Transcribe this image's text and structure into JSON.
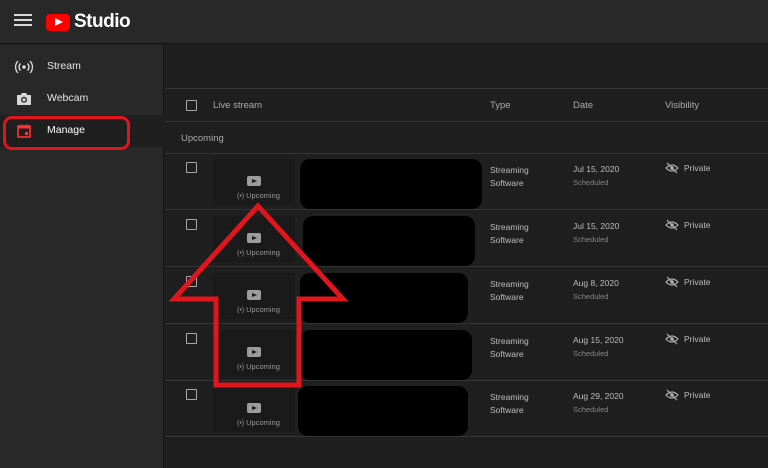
{
  "app": {
    "title": "Studio"
  },
  "colors": {
    "accent_red": "#ff0000",
    "highlight_red": "#e0161c",
    "background": "#1f1f1f",
    "panel": "#282828"
  },
  "sidebar": {
    "items": [
      {
        "label": "Stream",
        "icon": "live-broadcast-icon"
      },
      {
        "label": "Webcam",
        "icon": "camera-icon"
      },
      {
        "label": "Manage",
        "icon": "calendar-icon",
        "active": true
      }
    ]
  },
  "table": {
    "headers": {
      "live_stream": "Live stream",
      "type": "Type",
      "date": "Date",
      "visibility": "Visibility"
    },
    "section": "Upcoming",
    "rows": [
      {
        "thumb_status": "Upcoming",
        "type_line1": "Streaming",
        "type_line2": "Software",
        "date": "Jul 15, 2020",
        "status": "Scheduled",
        "visibility": "Private"
      },
      {
        "thumb_status": "Upcoming",
        "type_line1": "Streaming",
        "type_line2": "Software",
        "date": "Jul 15, 2020",
        "status": "Scheduled",
        "visibility": "Private"
      },
      {
        "thumb_status": "Upcoming",
        "type_line1": "Streaming",
        "type_line2": "Software",
        "date": "Aug 8, 2020",
        "status": "Scheduled",
        "visibility": "Private"
      },
      {
        "thumb_status": "Upcoming",
        "type_line1": "Streaming",
        "type_line2": "Software",
        "date": "Aug 15, 2020",
        "status": "Scheduled",
        "visibility": "Private"
      },
      {
        "thumb_status": "Upcoming",
        "type_line1": "Streaming",
        "type_line2": "Software",
        "date": "Aug 29, 2020",
        "status": "Scheduled",
        "visibility": "Private"
      }
    ]
  }
}
